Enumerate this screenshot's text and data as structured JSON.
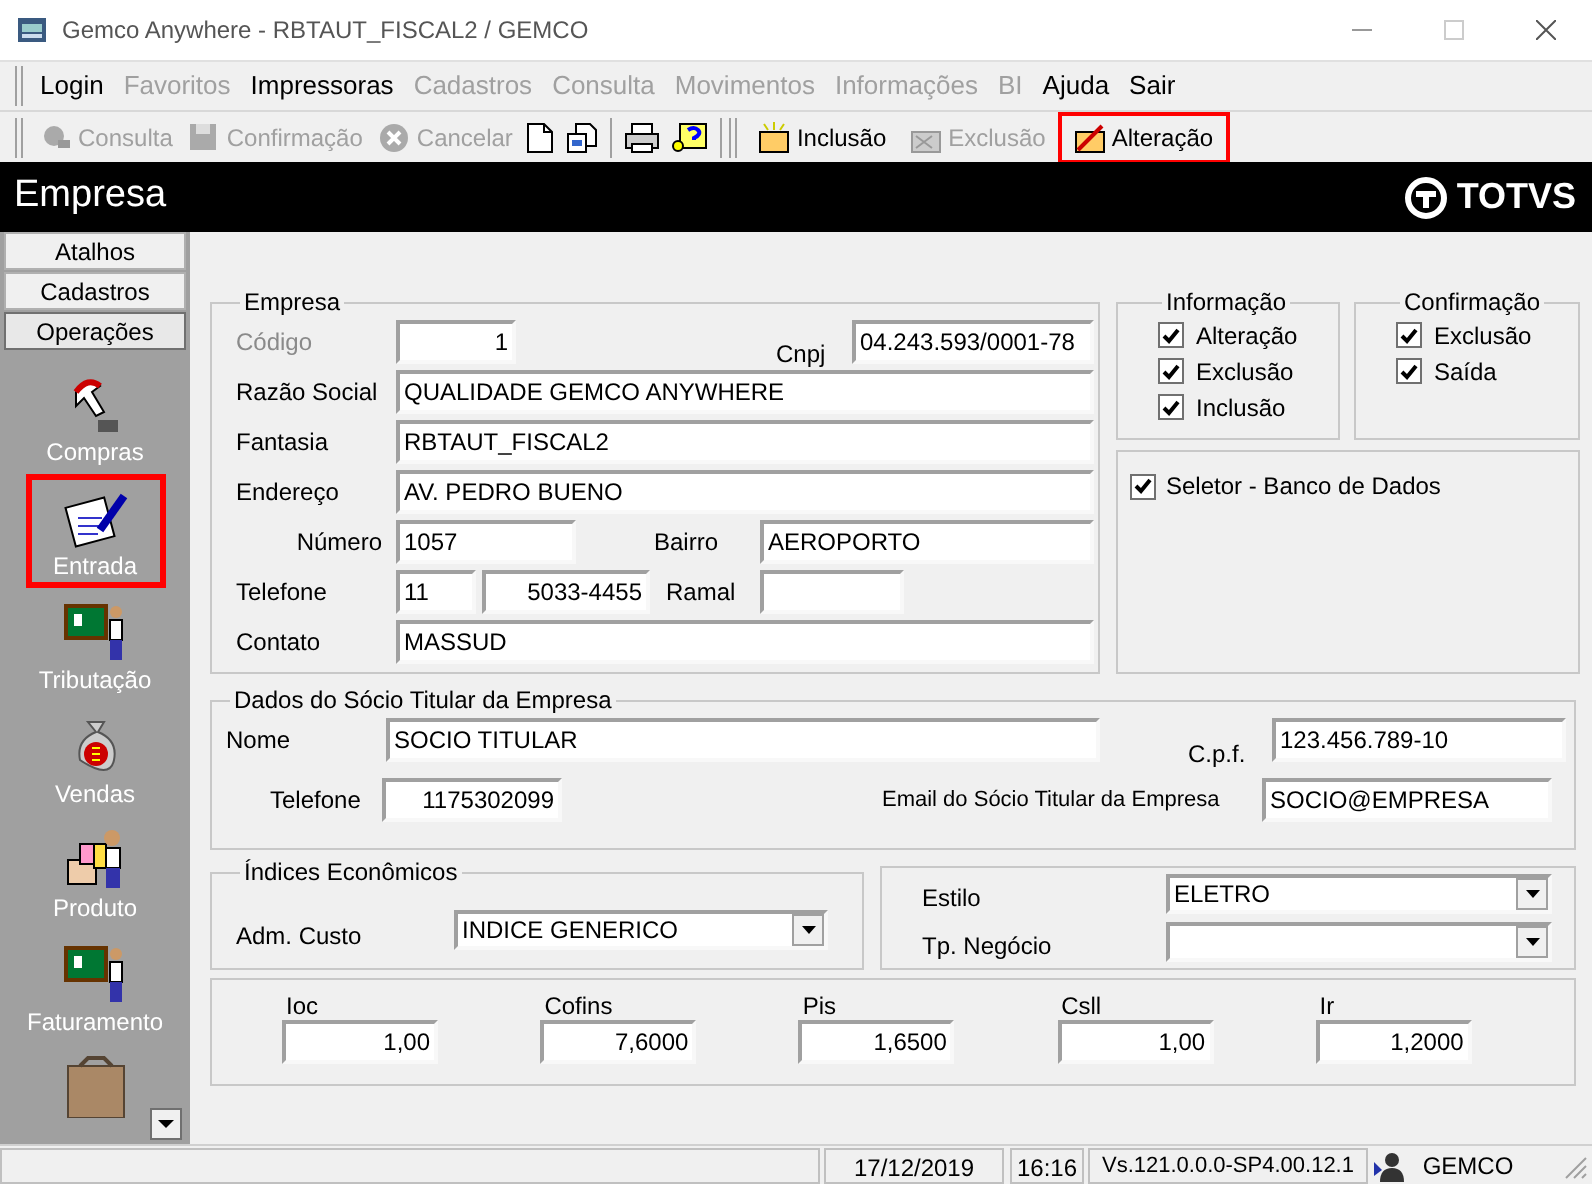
{
  "window": {
    "title": "Gemco Anywhere - RBTAUT_FISCAL2 / GEMCO"
  },
  "menu": [
    {
      "label": "Login",
      "disabled": false
    },
    {
      "label": "Favoritos",
      "disabled": true
    },
    {
      "label": "Impressoras",
      "disabled": false
    },
    {
      "label": "Cadastros",
      "disabled": true
    },
    {
      "label": "Consulta",
      "disabled": true
    },
    {
      "label": "Movimentos",
      "disabled": true
    },
    {
      "label": "Informações",
      "disabled": true
    },
    {
      "label": "BI",
      "disabled": true
    },
    {
      "label": "Ajuda",
      "disabled": false
    },
    {
      "label": "Sair",
      "disabled": false
    }
  ],
  "toolbar": {
    "actions": [
      {
        "label": "Consulta",
        "disabled": true
      },
      {
        "label": "Confirmação",
        "disabled": true
      },
      {
        "label": "Cancelar",
        "disabled": true
      }
    ],
    "record_actions": [
      {
        "label": "Inclusão",
        "disabled": false,
        "highlighted": false
      },
      {
        "label": "Exclusão",
        "disabled": true,
        "highlighted": false
      },
      {
        "label": "Alteração",
        "disabled": false,
        "highlighted": true
      }
    ]
  },
  "header": {
    "title": "Empresa",
    "logo": "TOTVS"
  },
  "sidebar": {
    "tabs": [
      {
        "label": "Atalhos",
        "selected": false
      },
      {
        "label": "Cadastros",
        "selected": false
      },
      {
        "label": "Operações",
        "selected": true
      }
    ],
    "items": [
      {
        "label": "Compras",
        "highlighted": false
      },
      {
        "label": "Entrada",
        "highlighted": true
      },
      {
        "label": "Tributação",
        "highlighted": false
      },
      {
        "label": "Vendas",
        "highlighted": false
      },
      {
        "label": "Produto",
        "highlighted": false
      },
      {
        "label": "Faturamento",
        "highlighted": false
      }
    ]
  },
  "empresa": {
    "title": "Empresa",
    "codigo": {
      "label": "Código",
      "value": "1",
      "disabled": true
    },
    "cnpj": {
      "label": "Cnpj",
      "value": "04.243.593/0001-78"
    },
    "razao_social": {
      "label": "Razão Social",
      "value": "QUALIDADE GEMCO ANYWHERE"
    },
    "fantasia": {
      "label": "Fantasia",
      "value": "RBTAUT_FISCAL2"
    },
    "endereco": {
      "label": "Endereço",
      "value": "AV. PEDRO BUENO"
    },
    "numero": {
      "label": "Número",
      "value": "1057"
    },
    "bairro": {
      "label": "Bairro",
      "value": "AEROPORTO"
    },
    "telefone": {
      "label": "Telefone",
      "ddd": "11",
      "value": "5033-4455"
    },
    "ramal": {
      "label": "Ramal"
    },
    "contato": {
      "label": "Contato",
      "value": "MASSUD"
    }
  },
  "informacao": {
    "title": "Informação",
    "options": [
      {
        "label": "Alteração",
        "checked": true
      },
      {
        "label": "Exclusão",
        "checked": true
      },
      {
        "label": "Inclusão",
        "checked": true
      }
    ]
  },
  "confirmacao": {
    "title": "Confirmação",
    "options": [
      {
        "label": "Exclusão",
        "checked": true
      },
      {
        "label": "Saída",
        "checked": true
      }
    ]
  },
  "seletor": {
    "label": "Seletor - Banco de Dados",
    "checked": true
  },
  "socio": {
    "title": "Dados do Sócio Titular da Empresa",
    "nome": {
      "label": "Nome",
      "value": "SOCIO TITULAR"
    },
    "cpf": {
      "label": "C.p.f.",
      "value": "123.456.789-10"
    },
    "telefone": {
      "label": "Telefone",
      "value": "1175302099"
    },
    "email": {
      "label": "Email do Sócio Titular da Empresa",
      "value": "SOCIO@EMPRESA"
    }
  },
  "indices": {
    "title": "Índices Econômicos",
    "adm_custo": {
      "label": "Adm. Custo",
      "value": "INDICE GENERICO"
    }
  },
  "estilo": {
    "label": "Estilo",
    "value": "ELETRO"
  },
  "tp_negocio": {
    "label": "Tp. Negócio"
  },
  "taxes": [
    {
      "label": "Ioc",
      "value": "1,00"
    },
    {
      "label": "Cofins",
      "value": "7,6000"
    },
    {
      "label": "Pis",
      "value": "1,6500"
    },
    {
      "label": "Csll",
      "value": "1,00"
    },
    {
      "label": "Ir",
      "value": "1,2000"
    }
  ],
  "status_bar": {
    "date": "17/12/2019",
    "time": "16:16",
    "version": "Vs.121.0.0.0-SP4.00.12.1",
    "user": "GEMCO"
  }
}
